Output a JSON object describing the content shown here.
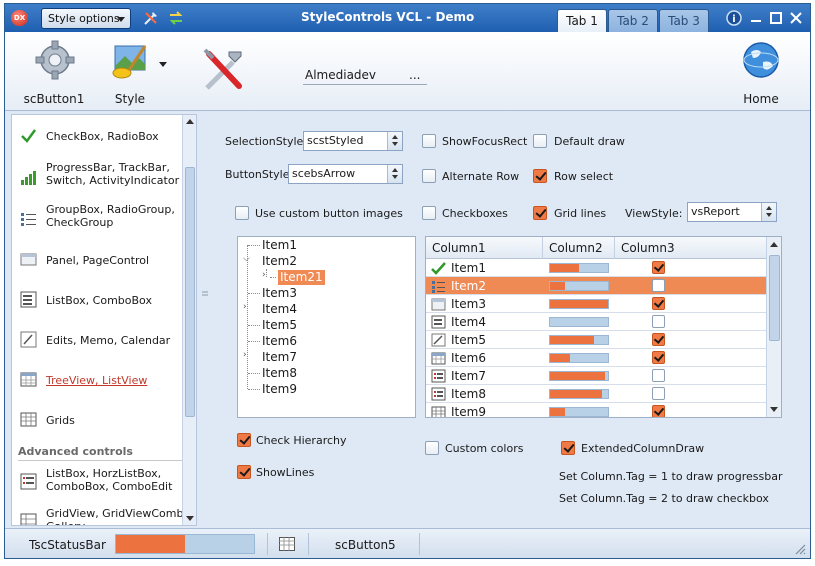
{
  "window": {
    "title": "StyleControls VCL - Demo",
    "app_icon_text": "DX",
    "style_options": "Style options",
    "tabs": [
      "Tab 1",
      "Tab 2",
      "Tab 3"
    ],
    "active_tab": 0
  },
  "ribbon": {
    "button1": "scButton1",
    "style": "Style",
    "edit_text": "Almediadev",
    "edit_dots": "...",
    "home": "Home"
  },
  "nav": {
    "items": [
      "CheckBox, RadioBox",
      "ProgressBar, TrackBar, Switch, ActivityIndicator",
      "GroupBox, RadioGroup, CheckGroup",
      "Panel, PageControl",
      "ListBox, ComboBox",
      "Edits, Memo, Calendar",
      "TreeView, ListView",
      "Grids"
    ],
    "selected_index": 6,
    "advanced_heading": "Advanced controls",
    "advanced_items": [
      "ListBox, HorzListBox, ComboBox, ComboEdit",
      "GridView, GridViewCombo, Gallery"
    ]
  },
  "options": {
    "selection_style_label": "SelectionStyle:",
    "selection_style_value": "scstStyled",
    "button_style_label": "ButtonStyle:",
    "button_style_value": "scebsArrow",
    "show_focus_rect": "ShowFocusRect",
    "default_draw": "Default draw",
    "alternate_row": "Alternate Row",
    "row_select": "Row select",
    "use_custom_button_images": "Use custom button images",
    "checkboxes": "Checkboxes",
    "grid_lines": "Grid lines",
    "view_style_label": "ViewStyle:",
    "view_style_value": "vsReport",
    "check_hierarchy": "Check Hierarchy",
    "show_lines": "ShowLines",
    "custom_colors": "Custom colors",
    "extended_column_draw": "ExtendedColumnDraw",
    "note1": "Set Column.Tag = 1 to draw progressbar",
    "note2": "Set Column.Tag = 2 to draw checkbox",
    "checked": {
      "show_focus_rect": false,
      "default_draw": false,
      "alternate_row": false,
      "row_select": true,
      "use_custom_button_images": false,
      "checkboxes": false,
      "grid_lines": true,
      "check_hierarchy": true,
      "show_lines": true,
      "custom_colors": false,
      "extended_column_draw": true
    }
  },
  "tree": {
    "nodes": [
      "Item1",
      "Item2",
      "Item21",
      "Item3",
      "Item4",
      "Item5",
      "Item6",
      "Item7",
      "Item8",
      "Item9"
    ],
    "selected": "Item21"
  },
  "grid": {
    "columns": [
      "Column1",
      "Column2",
      "Column3"
    ],
    "rows": [
      {
        "name": "Item1",
        "icon": "check-icon",
        "progress": 0.5,
        "checked": true
      },
      {
        "name": "Item2",
        "icon": "list-icon",
        "progress": 0.25,
        "checked": false,
        "selected": true
      },
      {
        "name": "Item3",
        "icon": "panel-icon",
        "progress": 1.0,
        "checked": true
      },
      {
        "name": "Item4",
        "icon": "listbox-icon",
        "progress": 0.0,
        "checked": false
      },
      {
        "name": "Item5",
        "icon": "edit-icon",
        "progress": 0.75,
        "checked": true
      },
      {
        "name": "Item6",
        "icon": "calendar-icon",
        "progress": 0.35,
        "checked": true
      },
      {
        "name": "Item7",
        "icon": "listitem-icon",
        "progress": 0.95,
        "checked": false
      },
      {
        "name": "Item8",
        "icon": "listitem-icon",
        "progress": 0.9,
        "checked": false
      },
      {
        "name": "Item9",
        "icon": "grid-icon",
        "progress": 0.25,
        "checked": true
      }
    ]
  },
  "statusbar": {
    "label": "TscStatusBar",
    "progress": 0.5,
    "button": "scButton5"
  }
}
